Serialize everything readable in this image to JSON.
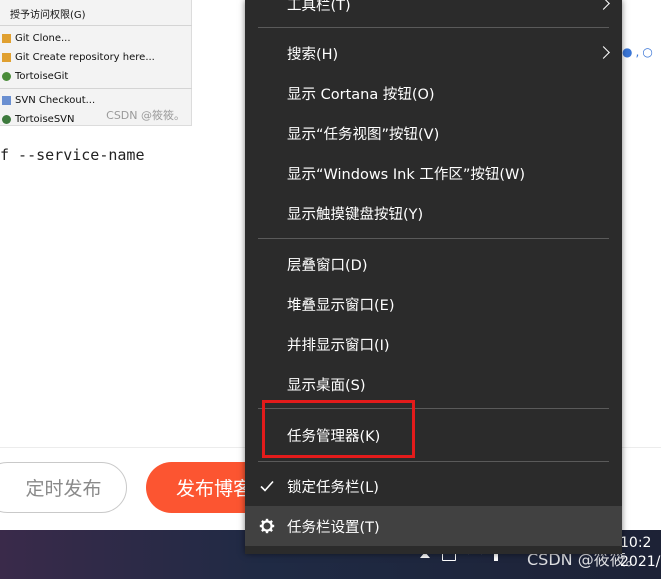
{
  "background": {
    "context_thumb": {
      "items": [
        {
          "label": "授予访问权限(G)",
          "icon": "none"
        },
        {
          "label": "Git Clone...",
          "icon": "git-icon"
        },
        {
          "label": "Git Create repository here...",
          "icon": "git-icon"
        },
        {
          "label": "TortoiseGit",
          "icon": "tortoisegit-icon"
        },
        {
          "label": "SVN Checkout...",
          "icon": "svn-icon"
        },
        {
          "label": "TortoiseSVN",
          "icon": "tortoisesvn-icon"
        }
      ],
      "watermark": "CSDN @筱筱。"
    },
    "code_text": "f --service-name",
    "footer": {
      "schedule_label": "定时发布",
      "publish_label": "发布博客"
    }
  },
  "menu": {
    "items": [
      {
        "label": "工具栏(T)",
        "submenu": true
      },
      {
        "label": "搜索(H)",
        "submenu": true
      },
      {
        "label": "显示 Cortana 按钮(O)"
      },
      {
        "label": "显示“任务视图”按钮(V)"
      },
      {
        "label": "显示“Windows Ink 工作区”按钮(W)"
      },
      {
        "label": "显示触摸键盘按钮(Y)"
      },
      {
        "label": "层叠窗口(D)"
      },
      {
        "label": "堆叠显示窗口(E)"
      },
      {
        "label": "并排显示窗口(I)"
      },
      {
        "label": "显示桌面(S)"
      },
      {
        "label": "任务管理器(K)",
        "highlighted_by_annotation": true
      },
      {
        "label": "锁定任务栏(L)",
        "checked": true
      },
      {
        "label": "任务栏设置(T)",
        "icon": "gear-icon",
        "hovered": true
      }
    ]
  },
  "taskbar": {
    "watermark": "CSDN @筱筱。",
    "clock_time": "10:2",
    "clock_date": "2021/"
  },
  "annotation_color": "#e31b1b",
  "accent_color": "#fc5531"
}
